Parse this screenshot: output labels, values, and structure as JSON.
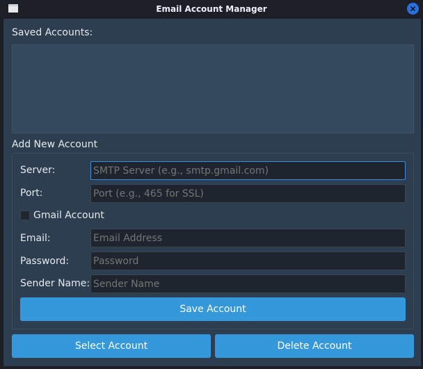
{
  "window": {
    "title": "Email Account Manager"
  },
  "saved": {
    "label": "Saved Accounts:"
  },
  "form": {
    "title": "Add New Account",
    "server": {
      "label": "Server:",
      "placeholder": "SMTP Server (e.g., smtp.gmail.com)"
    },
    "port": {
      "label": "Port:",
      "placeholder": "Port (e.g., 465 for SSL)"
    },
    "gmail": {
      "label": "Gmail Account",
      "checked": false
    },
    "email": {
      "label": "Email:",
      "placeholder": "Email Address"
    },
    "password": {
      "label": "Password:",
      "placeholder": "Password"
    },
    "sender": {
      "label": "Sender Name:",
      "placeholder": "Sender Name"
    },
    "save": "Save Account"
  },
  "actions": {
    "select": "Select Account",
    "delete": "Delete Account"
  }
}
